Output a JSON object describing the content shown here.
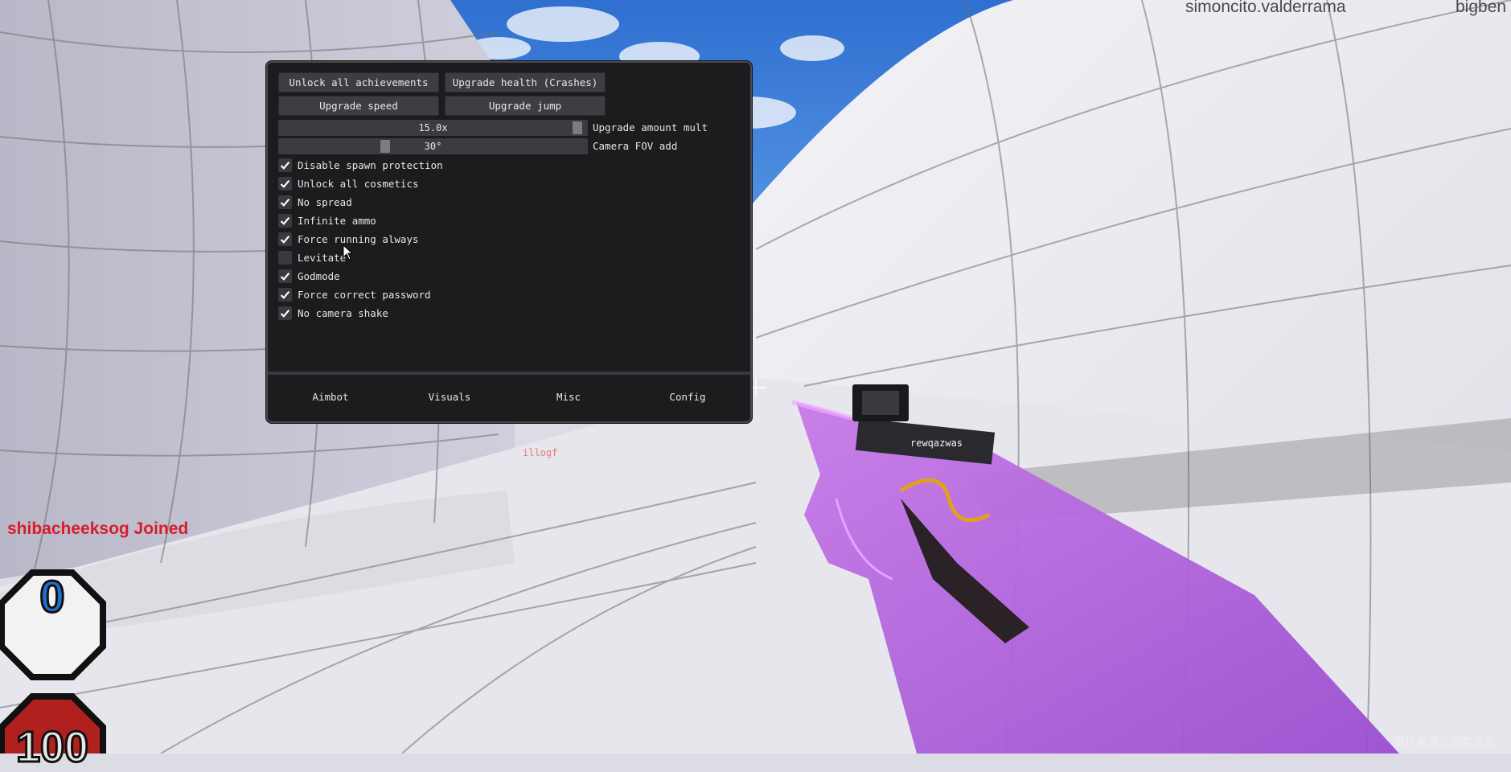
{
  "hud": {
    "top_player_1": "simoncito.valderrama",
    "top_player_2": "bigben",
    "join_message": "shibacheeksog Joined",
    "armor": "0",
    "health": "100",
    "player_tag_1": "rewqazwas",
    "player_tag_2": "illogf",
    "watermark": "图片来源@浪客论坛"
  },
  "menu": {
    "buttons": {
      "unlock_achievements": "Unlock all achievements",
      "upgrade_health": "Upgrade health (Crashes)",
      "upgrade_speed": "Upgrade speed",
      "upgrade_jump": "Upgrade jump"
    },
    "sliders": [
      {
        "value_text": "15.0x",
        "label": "Upgrade amount mult",
        "fraction": 0.98
      },
      {
        "value_text": "30°",
        "label": "Camera FOV add",
        "fraction": 0.34
      }
    ],
    "checkboxes": [
      {
        "label": "Disable spawn protection",
        "checked": true
      },
      {
        "label": "Unlock all cosmetics",
        "checked": true
      },
      {
        "label": "No spread",
        "checked": true
      },
      {
        "label": "Infinite ammo",
        "checked": true
      },
      {
        "label": "Force running always",
        "checked": true
      },
      {
        "label": "Levitate",
        "checked": false
      },
      {
        "label": "Godmode",
        "checked": true
      },
      {
        "label": "Force correct password",
        "checked": true
      },
      {
        "label": "No camera shake",
        "checked": true
      }
    ],
    "tabs": [
      "Aimbot",
      "Visuals",
      "Misc",
      "Config"
    ]
  },
  "colors": {
    "menu_bg": "#1c1c1e",
    "button_bg": "#3e3e42",
    "join_text": "#d81c2a",
    "armor_text": "#1e6fd0",
    "weapon_glow": "#b45ce6"
  }
}
